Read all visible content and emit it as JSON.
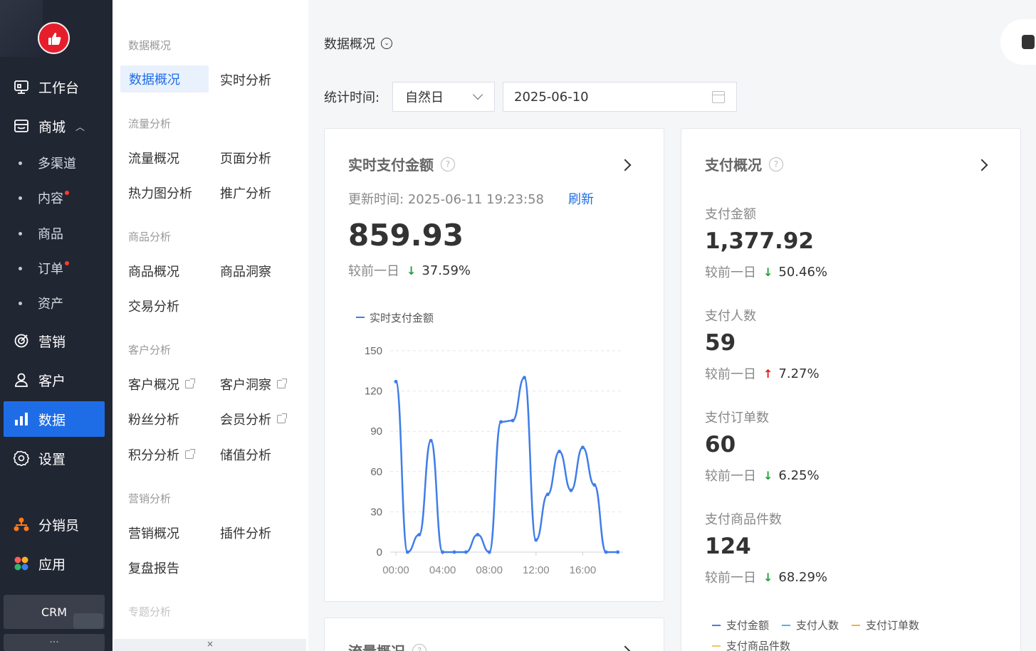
{
  "nav": {
    "main_items": [
      {
        "label": "工作台",
        "icon": "workbench-icon"
      },
      {
        "label": "商城",
        "icon": "store-icon"
      },
      {
        "label": "营销",
        "icon": "target-icon"
      },
      {
        "label": "客户",
        "icon": "user-icon"
      },
      {
        "label": "数据",
        "icon": "bar-chart-icon"
      },
      {
        "label": "设置",
        "icon": "gear-icon"
      },
      {
        "label": "分销员",
        "icon": "org-icon"
      },
      {
        "label": "应用",
        "icon": "apps-icon"
      }
    ],
    "sub_items": [
      {
        "label": "多渠道",
        "badge": false
      },
      {
        "label": "内容",
        "badge": true
      },
      {
        "label": "商品",
        "badge": false
      },
      {
        "label": "订单",
        "badge": true
      },
      {
        "label": "资产",
        "badge": false
      }
    ],
    "crm_label": "CRM",
    "more_label": "···",
    "active": "数据"
  },
  "menu": {
    "groups": [
      {
        "title": "数据概况",
        "items": [
          "数据概况",
          "实时分析"
        ]
      },
      {
        "title": "流量分析",
        "items": [
          "流量概况",
          "页面分析",
          "热力图分析",
          "推广分析"
        ]
      },
      {
        "title": "商品分析",
        "items": [
          "商品概况",
          "商品洞察",
          "交易分析"
        ]
      },
      {
        "title": "客户分析",
        "items": [
          "客户概况",
          "客户洞察",
          "粉丝分析",
          "会员分析",
          "积分分析",
          "储值分析"
        ]
      },
      {
        "title": "营销分析",
        "items": [
          "营销概况",
          "插件分析",
          "复盘报告"
        ]
      },
      {
        "title": "专题分析",
        "items": []
      }
    ],
    "bottom_label": "×"
  },
  "main": {
    "title": "数据概况",
    "filter_label": "统计时间:",
    "period_value": "自然日",
    "date_value": "2025-06-10",
    "realtime_card": {
      "title": "实时支付金额",
      "update_prefix": "更新时间:",
      "update_time": "2025-06-11 19:23:58",
      "refresh_label": "刷新",
      "value": "859.93",
      "compare_label": "较前一日",
      "compare_dir": "↓",
      "compare_pct": "37.59%"
    },
    "payment_card": {
      "title": "支付概况",
      "metrics": [
        {
          "label": "支付金额",
          "value": "1,377.92",
          "compare_label": "较前一日",
          "dir": "↓",
          "pct": "50.46%"
        },
        {
          "label": "支付人数",
          "value": "59",
          "compare_label": "较前一日",
          "dir": "↑",
          "pct": "7.27%"
        },
        {
          "label": "支付订单数",
          "value": "60",
          "compare_label": "较前一日",
          "dir": "↓",
          "pct": "6.25%"
        },
        {
          "label": "支付商品件数",
          "value": "124",
          "compare_label": "较前一日",
          "dir": "↓",
          "pct": "68.29%"
        }
      ],
      "legend": [
        {
          "name": "支付金额",
          "color": "#3f7ee8"
        },
        {
          "name": "支付人数",
          "color": "#4fb3e8"
        },
        {
          "name": "支付订单数",
          "color": "#f5b041"
        },
        {
          "name": "支付商品件数",
          "color": "#f5c26b"
        }
      ]
    },
    "traffic_card": {
      "title": "流量概况"
    }
  },
  "chart_data": {
    "type": "line",
    "title": "",
    "xlabel": "",
    "ylabel": "",
    "legend": [
      "实时支付金额"
    ],
    "x_ticks": [
      "00:00",
      "04:00",
      "08:00",
      "12:00",
      "16:00"
    ],
    "y_ticks": [
      0,
      30,
      60,
      90,
      120,
      150
    ],
    "ylim": [
      0,
      150
    ],
    "grid": true,
    "series": [
      {
        "name": "实时支付金额",
        "color": "#3f7ee8",
        "x": [
          0,
          1,
          2,
          3,
          4,
          5,
          6,
          7,
          8,
          9,
          10,
          11,
          12,
          13,
          14,
          15,
          16,
          17,
          18,
          19
        ],
        "values": [
          127,
          0,
          13,
          83,
          0,
          0,
          0,
          13,
          0,
          97,
          98,
          130,
          9,
          43,
          75,
          46,
          78,
          50,
          0,
          0
        ]
      }
    ]
  }
}
